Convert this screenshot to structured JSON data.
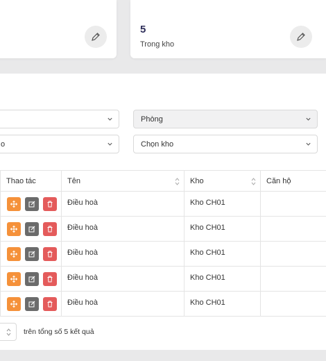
{
  "stats": [
    {
      "value": "",
      "label": "",
      "icon": "pencil-icon"
    },
    {
      "value": "5",
      "label": "Trong kho",
      "icon": "pencil-icon"
    }
  ],
  "filters": {
    "select_left_1": "",
    "select_room": "Phòng",
    "select_left_2": "o",
    "select_warehouse": "Chọn kho"
  },
  "table": {
    "headers": [
      "Thao tác",
      "Tên",
      "Kho",
      "Căn hộ"
    ],
    "rows": [
      {
        "name": "Điều hoà",
        "warehouse": "Kho CH01",
        "apartment": ""
      },
      {
        "name": "Điều hoà",
        "warehouse": "Kho CH01",
        "apartment": ""
      },
      {
        "name": "Điều hoà",
        "warehouse": "Kho CH01",
        "apartment": ""
      },
      {
        "name": "Điều hoà",
        "warehouse": "Kho CH01",
        "apartment": ""
      },
      {
        "name": "Điều hoà",
        "warehouse": "Kho CH01",
        "apartment": ""
      }
    ]
  },
  "footer": {
    "result_text": "trên tổng số 5 kết quả"
  },
  "colors": {
    "move": "#f5913a",
    "edit": "#6b6b6b",
    "delete": "#e45b5b"
  }
}
